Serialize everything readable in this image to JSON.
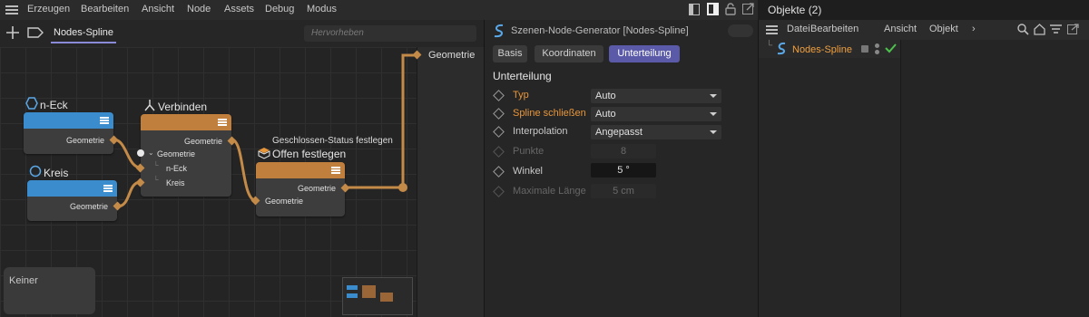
{
  "menubar": {
    "items": [
      "Erzeugen",
      "Bearbeiten",
      "Ansicht",
      "Node",
      "Assets",
      "Debug",
      "Modus"
    ]
  },
  "node_editor": {
    "tab_label": "Nodes-Spline",
    "search_placeholder": "Hervorheben",
    "output_label": "Geometrie",
    "nodes": {
      "neck": {
        "title": "n-Eck",
        "port_out": "Geometrie",
        "color": "#3a8ccc"
      },
      "kreis": {
        "title": "Kreis",
        "port_out": "Geometrie",
        "color": "#3a8ccc"
      },
      "verbinden": {
        "title": "Verbinden",
        "port_out": "Geometrie",
        "group_label": "Geometrie",
        "inputs": [
          "n-Eck",
          "Kreis"
        ],
        "color": "#c07f3c"
      },
      "offen": {
        "subtitle": "Geschlossen-Status festlegen",
        "title": "Offen festlegen",
        "port_out": "Geometrie",
        "port_in": "Geometrie",
        "color": "#c07f3c"
      }
    },
    "info_box": "Keiner"
  },
  "attribute_manager": {
    "title": "Szenen-Node-Generator [Nodes-Spline]",
    "tabs": [
      "Basis",
      "Koordinaten",
      "Unterteilung"
    ],
    "active_tab": "Unterteilung",
    "section_title": "Unterteilung",
    "properties": [
      {
        "label": "Typ",
        "value": "Auto",
        "kind": "dropdown",
        "highlight": true
      },
      {
        "label": "Spline schließen",
        "value": "Auto",
        "kind": "dropdown",
        "highlight": true
      },
      {
        "label": "Interpolation",
        "value": "Angepasst",
        "kind": "dropdown",
        "highlight": false
      },
      {
        "label": "Punkte",
        "value": "8",
        "kind": "field-disabled",
        "highlight": false
      },
      {
        "label": "Winkel",
        "value": "5 °",
        "kind": "field",
        "highlight": false
      },
      {
        "label": "Maximale Länge",
        "value": "5 cm",
        "kind": "field-disabled",
        "highlight": false
      }
    ]
  },
  "object_manager": {
    "title": "Objekte (2)",
    "menu": [
      "Datei",
      "Bearbeiten",
      "Ansicht",
      "Objekt"
    ],
    "objects": [
      {
        "name": "Nodes-Spline"
      }
    ]
  },
  "colors": {
    "accent_orange": "#e8963a",
    "tab_active": "#5a5aa8",
    "node_blue": "#3a8ccc",
    "node_orange": "#c07f3c",
    "check_green": "#4cc24c"
  }
}
